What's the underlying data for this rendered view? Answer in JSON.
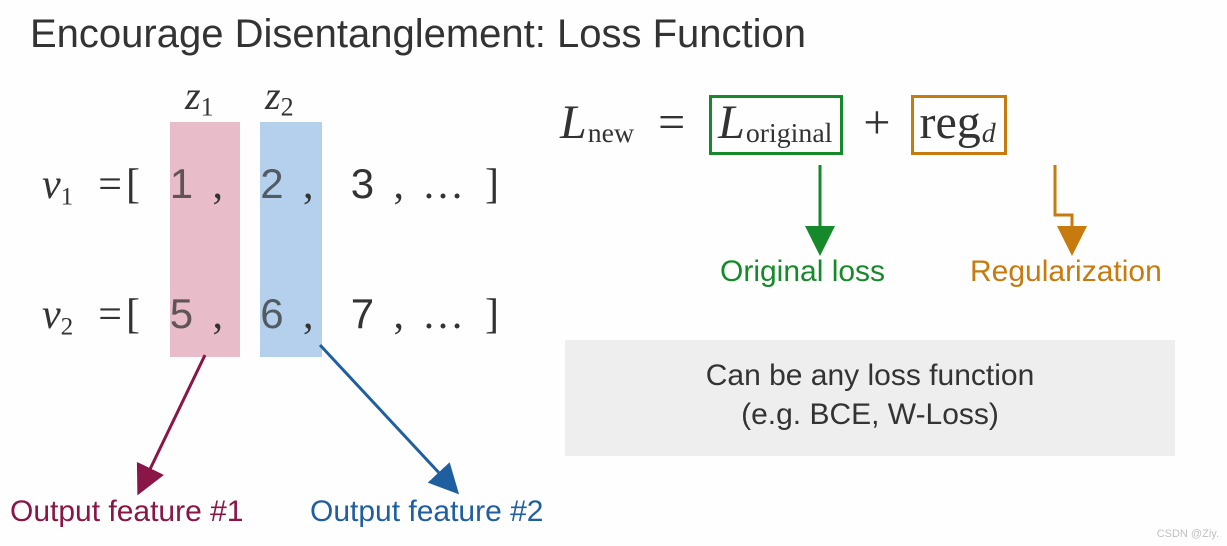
{
  "title": "Encourage Disentanglement: Loss Function",
  "left": {
    "z_labels": [
      "z",
      "z"
    ],
    "z_subs": [
      "1",
      "2"
    ],
    "v1": {
      "name": "v",
      "sub": "1",
      "vals": [
        "1",
        "2",
        "3"
      ],
      "ellipsis": "…"
    },
    "v2": {
      "name": "v",
      "sub": "2",
      "vals": [
        "5",
        "6",
        "7"
      ],
      "ellipsis": "…"
    },
    "feature1_label": "Output feature #1",
    "feature2_label": "Output feature #2"
  },
  "equation": {
    "lhs_L": "L",
    "lhs_sub": "new",
    "eq": "=",
    "term1_L": "L",
    "term1_sub": "original",
    "plus": "+",
    "term2": "reg",
    "term2_sub": "d",
    "callout_original": "Original loss",
    "callout_reg": "Regularization"
  },
  "note": {
    "line1": "Can be any loss function",
    "line2": "(e.g. BCE, W-Loss)"
  },
  "watermark": "CSDN @Ziy.",
  "colors": {
    "green": "#168a2a",
    "orange": "#c77a0e",
    "pink": "#b85a78",
    "blue": "#1f5fa0",
    "maroon": "#8a1547"
  }
}
